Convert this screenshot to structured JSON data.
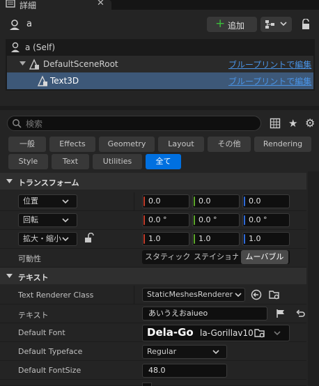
{
  "tab": {
    "title": "詳細"
  },
  "header": {
    "actor_name": "a",
    "add_label": "追加"
  },
  "tree": {
    "rows": [
      {
        "label": "a (Self)",
        "link": ""
      },
      {
        "label": "DefaultSceneRoot",
        "link": "ブループリントで編集"
      },
      {
        "label": "Text3D",
        "link": "ブループリントで編集"
      }
    ]
  },
  "search": {
    "placeholder": "検索"
  },
  "filters": {
    "row1": [
      "一般",
      "Effects",
      "Geometry",
      "Layout",
      "その他",
      "Rendering"
    ],
    "row2": [
      "Style",
      "Text",
      "Utilities",
      "全て"
    ],
    "active": "全て"
  },
  "transform": {
    "title": "トランスフォーム",
    "location": {
      "label": "位置",
      "x": "0.0",
      "y": "0.0",
      "z": "0.0"
    },
    "rotation": {
      "label": "回転",
      "x": "0.0 °",
      "y": "0.0 °",
      "z": "0.0 °"
    },
    "scale": {
      "label": "拡大・縮小",
      "x": "1.0",
      "y": "1.0",
      "z": "1.0"
    },
    "mobility": {
      "label": "可動性",
      "options": [
        "スタティック",
        "ステイショナリ",
        "ムーバブル"
      ],
      "selected": "ムーバブル"
    }
  },
  "text_section": {
    "title": "テキスト",
    "renderer_class": {
      "label": "Text Renderer Class",
      "value": "StaticMeshesRenderer"
    },
    "text": {
      "label": "テキスト",
      "value": "あいうえおaiueo"
    },
    "font": {
      "label": "Default Font",
      "preview": "Dela-Go",
      "value": "la-Gorillav10"
    },
    "typeface": {
      "label": "Default Typeface",
      "value": "Regular"
    },
    "fontsize": {
      "label": "Default FontSize",
      "value": "48.0"
    }
  }
}
